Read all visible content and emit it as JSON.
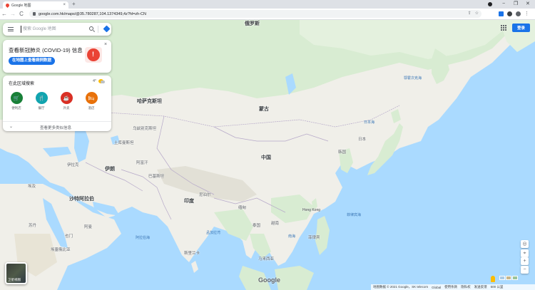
{
  "browser": {
    "tab_title": "Google 地图",
    "tab_close": "×",
    "new_tab": "+",
    "url": "google.com.hk/maps/@35.780287,104.1374349,4z?hl=zh-CN",
    "back": "←",
    "forward": "→",
    "reload": "C",
    "minimize": "−",
    "maximize": "❐",
    "close": "✕"
  },
  "search": {
    "placeholder": "搜索 Google 地图"
  },
  "covid": {
    "title": "查看新冠肺炎 (COVID-19) 信息",
    "button": "在地图上查看病例数据",
    "close": "×"
  },
  "nearby": {
    "title": "在此区域搜索",
    "temperature": "4°",
    "categories": [
      {
        "label": "便利店",
        "icon": "cart-icon",
        "color": "#188038"
      },
      {
        "label": "餐厅",
        "icon": "restaurant-icon",
        "color": "#12a4af"
      },
      {
        "label": "外卖",
        "icon": "takeout-icon",
        "color": "#d93025"
      },
      {
        "label": "酒店",
        "icon": "hotel-icon",
        "color": "#e8710a"
      }
    ],
    "more": "查看更多类似信息"
  },
  "header": {
    "signin": "登录"
  },
  "layers": {
    "label": "卫星视图"
  },
  "map_labels": {
    "russia": "俄罗斯",
    "kazakhstan": "哈萨克斯坦",
    "mongolia": "蒙古",
    "china": "中国",
    "india": "印度",
    "iran": "伊朗",
    "afghanistan": "阿富汗",
    "pakistan": "巴基斯坦",
    "saudi": "沙特阿拉伯",
    "iraq": "伊拉克",
    "turkmenistan": "土库曼斯坦",
    "uzbekistan": "乌兹别克斯坦",
    "japan": "日本",
    "south_korea": "韩国",
    "myanmar": "缅甸",
    "thailand": "泰国",
    "vietnam": "越南",
    "malaysia": "马来西亚",
    "hong_kong": "Hong Kong",
    "philippines": "菲律宾",
    "egypt": "埃及",
    "sudan": "苏丹",
    "ethiopia": "埃塞俄比亚",
    "yemen": "也门",
    "oman": "阿曼",
    "nepal": "尼泊尔",
    "bay_of_bengal": "孟加拉湾",
    "arabian_sea": "阿拉伯海",
    "sea_of_japan": "日本海",
    "sea_of_okhotsk": "鄂霍次克海",
    "south_china_sea": "南海",
    "philippine_sea": "菲律宾海",
    "sri_lanka": "斯里兰卡"
  },
  "footer": {
    "copyright": "地图数据 © 2021 Google，SK telecom",
    "global": "Global",
    "terms": "使用条款",
    "privacy": "隐私权",
    "feedback": "发送反馈",
    "scale": "500 公里"
  },
  "logo": "Google",
  "colors": {
    "water": "#aadaff",
    "land": "#f0efe9",
    "green_land": "#cde8c4",
    "accent": "#1a73e8"
  }
}
